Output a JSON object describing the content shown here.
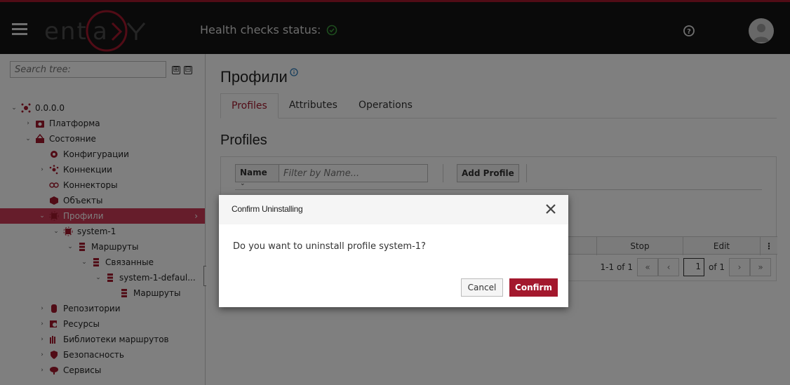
{
  "header": {
    "app_name": "entaxy",
    "health_label": "Health checks status:",
    "health_status": "ok",
    "icons": {
      "menu": "hamburger-icon",
      "health": "check-circle-icon",
      "help": "question-circle-icon",
      "avatar": "user-avatar-icon"
    }
  },
  "colors": {
    "brand": "#a3182d",
    "selected": "#cc3a56",
    "header_bg": "#151515",
    "health_ok": "#3c9a3c"
  },
  "sidebar": {
    "search_placeholder": "Search tree:",
    "expand_all": "⊞",
    "collapse_all": "⊟",
    "tree": [
      {
        "label": "0.0.0.0",
        "level": 0,
        "toggle": "⌄",
        "icon": "network-icon"
      },
      {
        "label": "Платформа",
        "level": 1,
        "toggle": "›",
        "icon": "platform-icon"
      },
      {
        "label": "Состояние",
        "level": 1,
        "toggle": "⌄",
        "icon": "state-icon"
      },
      {
        "label": "Конфигурации",
        "level": 2,
        "toggle": "",
        "icon": "gear-icon"
      },
      {
        "label": "Коннекции",
        "level": 2,
        "toggle": "›",
        "icon": "connections-icon"
      },
      {
        "label": "Коннекторы",
        "level": 2,
        "toggle": "",
        "icon": "connectors-icon"
      },
      {
        "label": "Объекты",
        "level": 2,
        "toggle": "",
        "icon": "cube-icon"
      },
      {
        "label": "Профили",
        "level": 2,
        "toggle": "⌄",
        "icon": "profile-icon",
        "selected": true
      },
      {
        "label": "system-1",
        "level": 3,
        "toggle": "⌄",
        "icon": "profile-icon"
      },
      {
        "label": "Маршруты",
        "level": 4,
        "toggle": "⌄",
        "icon": "routes-icon"
      },
      {
        "label": "Связанные",
        "level": 5,
        "toggle": "⌄",
        "icon": "routes-icon"
      },
      {
        "label": "system-1-defaul...",
        "level": 6,
        "toggle": "⌄",
        "icon": "routes-icon"
      },
      {
        "label": "Маршруты",
        "level": 7,
        "toggle": "",
        "icon": "routes-icon"
      },
      {
        "label": "Репозитории",
        "level": 2,
        "toggle": "›",
        "icon": "database-icon"
      },
      {
        "label": "Ресурсы",
        "level": 2,
        "toggle": "›",
        "icon": "resources-icon"
      },
      {
        "label": "Библиотеки маршрутов",
        "level": 2,
        "toggle": "›",
        "icon": "library-icon"
      },
      {
        "label": "Безопасность",
        "level": 2,
        "toggle": "›",
        "icon": "shield-icon"
      },
      {
        "label": "Сервисы",
        "level": 2,
        "toggle": "›",
        "icon": "cloud-services-icon"
      }
    ]
  },
  "main": {
    "page_title": "Профили",
    "tabs": [
      {
        "label": "Profiles",
        "active": true
      },
      {
        "label": "Attributes",
        "active": false
      },
      {
        "label": "Operations",
        "active": false
      }
    ],
    "section_title": "Profiles",
    "filter": {
      "field": "Name",
      "placeholder": "Filter by Name..."
    },
    "add_button": "Add Profile",
    "table_headers": [
      "Stop",
      "Edit",
      "⋮"
    ],
    "pager": {
      "range": "1-1 of 1",
      "page": "1",
      "of_pages": "of 1",
      "first": "«",
      "prev": "‹",
      "next": "›",
      "last": "»"
    }
  },
  "dialog": {
    "title": "Confirm Uninstalling",
    "message": "Do you want to uninstall profile system-1?",
    "cancel": "Cancel",
    "confirm": "Confirm"
  }
}
